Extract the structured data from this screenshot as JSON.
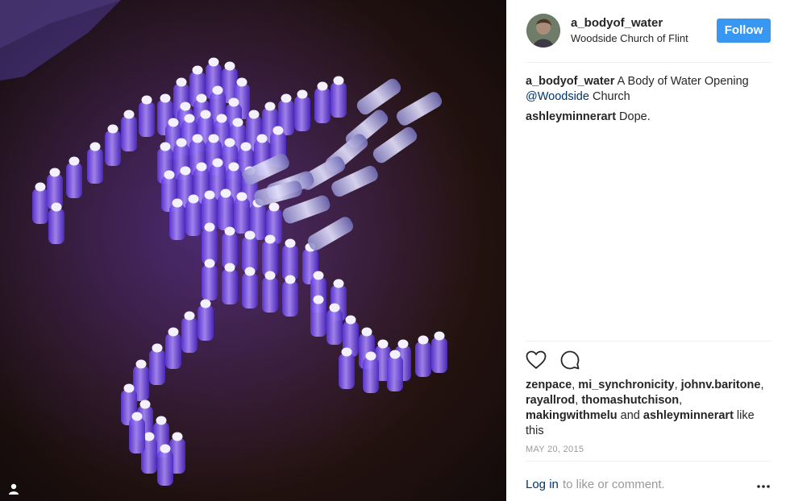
{
  "post": {
    "username": "a_bodyof_water",
    "location": "Woodside Church of Flint",
    "follow_label": "Follow",
    "caption_user": "a_bodyof_water",
    "caption_text_1": " A Body of Water Opening ",
    "caption_mention": "@Woodside",
    "caption_text_2": " Church",
    "comments": [
      {
        "user": "ashleyminnerart",
        "text": " Dope."
      }
    ],
    "likes": {
      "users": [
        "zenpace",
        "mi_synchronicity",
        "johnv.baritone",
        "rayallrod",
        "thomashutchison",
        "makingwithmelu",
        "ashleyminnerart"
      ],
      "and_text": " and",
      "suffix": " like this"
    },
    "date": "MAY 20, 2015",
    "login_link": "Log in",
    "login_rest": " to like or comment."
  },
  "icons": {
    "like": "heart-icon",
    "comment": "comment-icon",
    "more": "more-options-icon",
    "user_tag": "user-tag-icon"
  },
  "colors": {
    "follow_button": "#3897f0",
    "link": "#003569",
    "muted": "#999999",
    "border": "#efefef"
  }
}
